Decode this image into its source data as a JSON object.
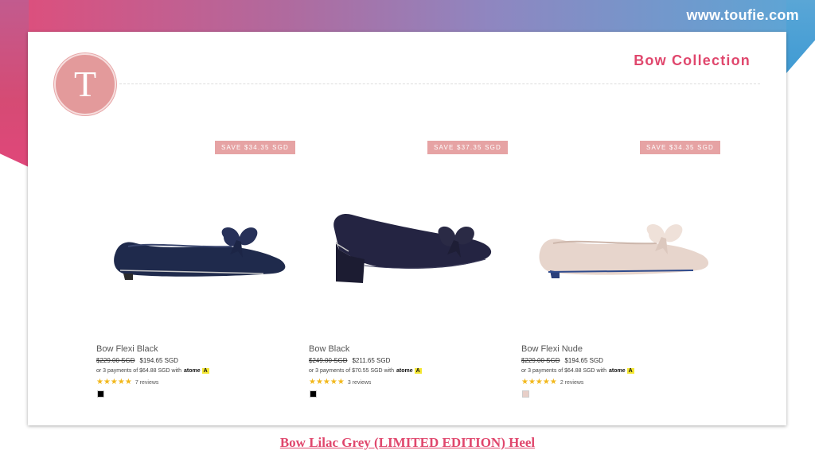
{
  "site": {
    "url": "www.toufie.com"
  },
  "brand": {
    "logo_letter": "T",
    "logo_color": "#e39a9b"
  },
  "collection": {
    "title": "Bow Collection"
  },
  "products": [
    {
      "badge": "SAVE $34.35 SGD",
      "name": "Bow Flexi Black",
      "old_price": "$229.00 SGD",
      "price": "$194.65 SGD",
      "installments": "or 3 payments of $64.88 SGD with",
      "atome": "atome",
      "atome_mark": "A",
      "stars": "★★★★★",
      "reviews": "7 reviews",
      "swatch_color": "#000000"
    },
    {
      "badge": "SAVE $37.35 SGD",
      "name": "Bow Black",
      "old_price": "$249.00 SGD",
      "price": "$211.65 SGD",
      "installments": "or 3 payments of $70.55 SGD with",
      "atome": "atome",
      "atome_mark": "A",
      "stars": "★★★★★",
      "reviews": "3 reviews",
      "swatch_color": "#000000"
    },
    {
      "badge": "SAVE $34.35 SGD",
      "name": "Bow Flexi Nude",
      "old_price": "$229.00 SGD",
      "price": "$194.65 SGD",
      "installments": "or 3 payments of $64.88 SGD with",
      "atome": "atome",
      "atome_mark": "A",
      "stars": "★★★★★",
      "reviews": "2 reviews",
      "swatch_color": "#e8cfc8"
    }
  ],
  "footer": {
    "link_text": "Bow Lilac Grey (LIMITED EDITION) Heel"
  },
  "colors": {
    "accent": "#e0476d",
    "badge": "#e6a3a4",
    "star": "#f2b81c"
  }
}
